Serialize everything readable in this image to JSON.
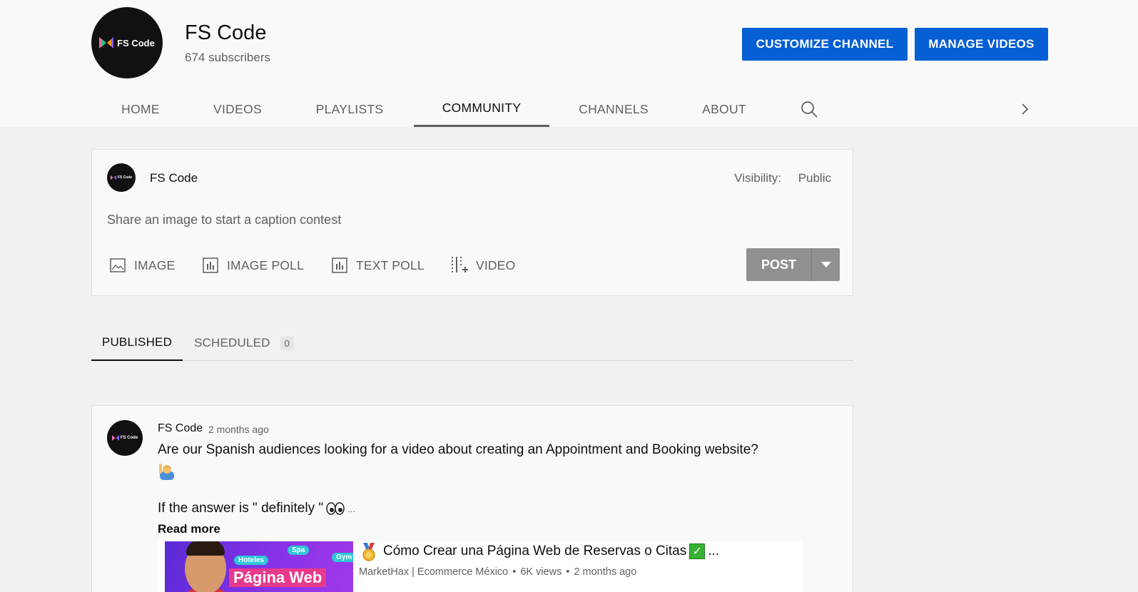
{
  "channel": {
    "name": "FS Code",
    "subscribers": "674 subscribers",
    "logo_text": "FS Code",
    "buttons": {
      "customize": "CUSTOMIZE CHANNEL",
      "manage": "MANAGE VIDEOS"
    }
  },
  "tabs": [
    {
      "label": "HOME"
    },
    {
      "label": "VIDEOS"
    },
    {
      "label": "PLAYLISTS"
    },
    {
      "label": "COMMUNITY",
      "active": true
    },
    {
      "label": "CHANNELS"
    },
    {
      "label": "ABOUT"
    }
  ],
  "composer": {
    "author": "FS Code",
    "visibility_label": "Visibility:",
    "visibility_value": "Public",
    "placeholder": "Share an image to start a caption contest",
    "attachments": [
      {
        "label": "IMAGE",
        "icon": "image-icon"
      },
      {
        "label": "IMAGE POLL",
        "icon": "image-poll-icon"
      },
      {
        "label": "TEXT POLL",
        "icon": "text-poll-icon"
      },
      {
        "label": "VIDEO",
        "icon": "video-icon"
      }
    ],
    "post_label": "POST"
  },
  "sub_tabs": {
    "published": "PUBLISHED",
    "scheduled": "SCHEDULED",
    "scheduled_count": "0"
  },
  "post": {
    "author": "FS Code",
    "time": "2 months ago",
    "text_1": "Are our Spanish audiences looking for a video about creating an Appointment and Booking website?",
    "text_2": "If the answer is \" definitely \"",
    "ellipsis": "...",
    "read_more": "Read more",
    "shared_video": {
      "title": "Cómo Crear una Página Web de Reservas o Citas",
      "title_ellipsis": "...",
      "channel": "MarketHax | Ecommerce México",
      "views": "6K views",
      "age": "2 months ago",
      "separator": "•",
      "thumbnail": {
        "title": "Página Web",
        "tags": [
          "Hoteles",
          "Spa",
          "Gym"
        ]
      }
    }
  },
  "colors": {
    "accent": "#065fd4",
    "page_bg": "#f1f1f1",
    "header_bg": "#f9f9f9",
    "post_disabled": "#909090"
  }
}
